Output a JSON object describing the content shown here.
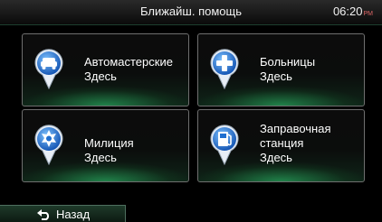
{
  "header": {
    "title": "Ближайш. помощь",
    "time": "06:20",
    "ampm": "PM"
  },
  "tiles": [
    {
      "icon": "car-icon",
      "line1": "Автомастерские",
      "line2": "Здесь"
    },
    {
      "icon": "plus-icon",
      "line1": "Больницы",
      "line2": "Здесь"
    },
    {
      "icon": "police-badge-icon",
      "line1": "Милиция",
      "line2": "Здесь"
    },
    {
      "icon": "fuel-pump-icon",
      "line1": "Заправочная",
      "line2": "станция",
      "line3": "Здесь"
    }
  ],
  "footer": {
    "back_label": "Назад"
  },
  "colors": {
    "accent_green": "#2aa860",
    "pin_blue": "#1f6fd0"
  }
}
